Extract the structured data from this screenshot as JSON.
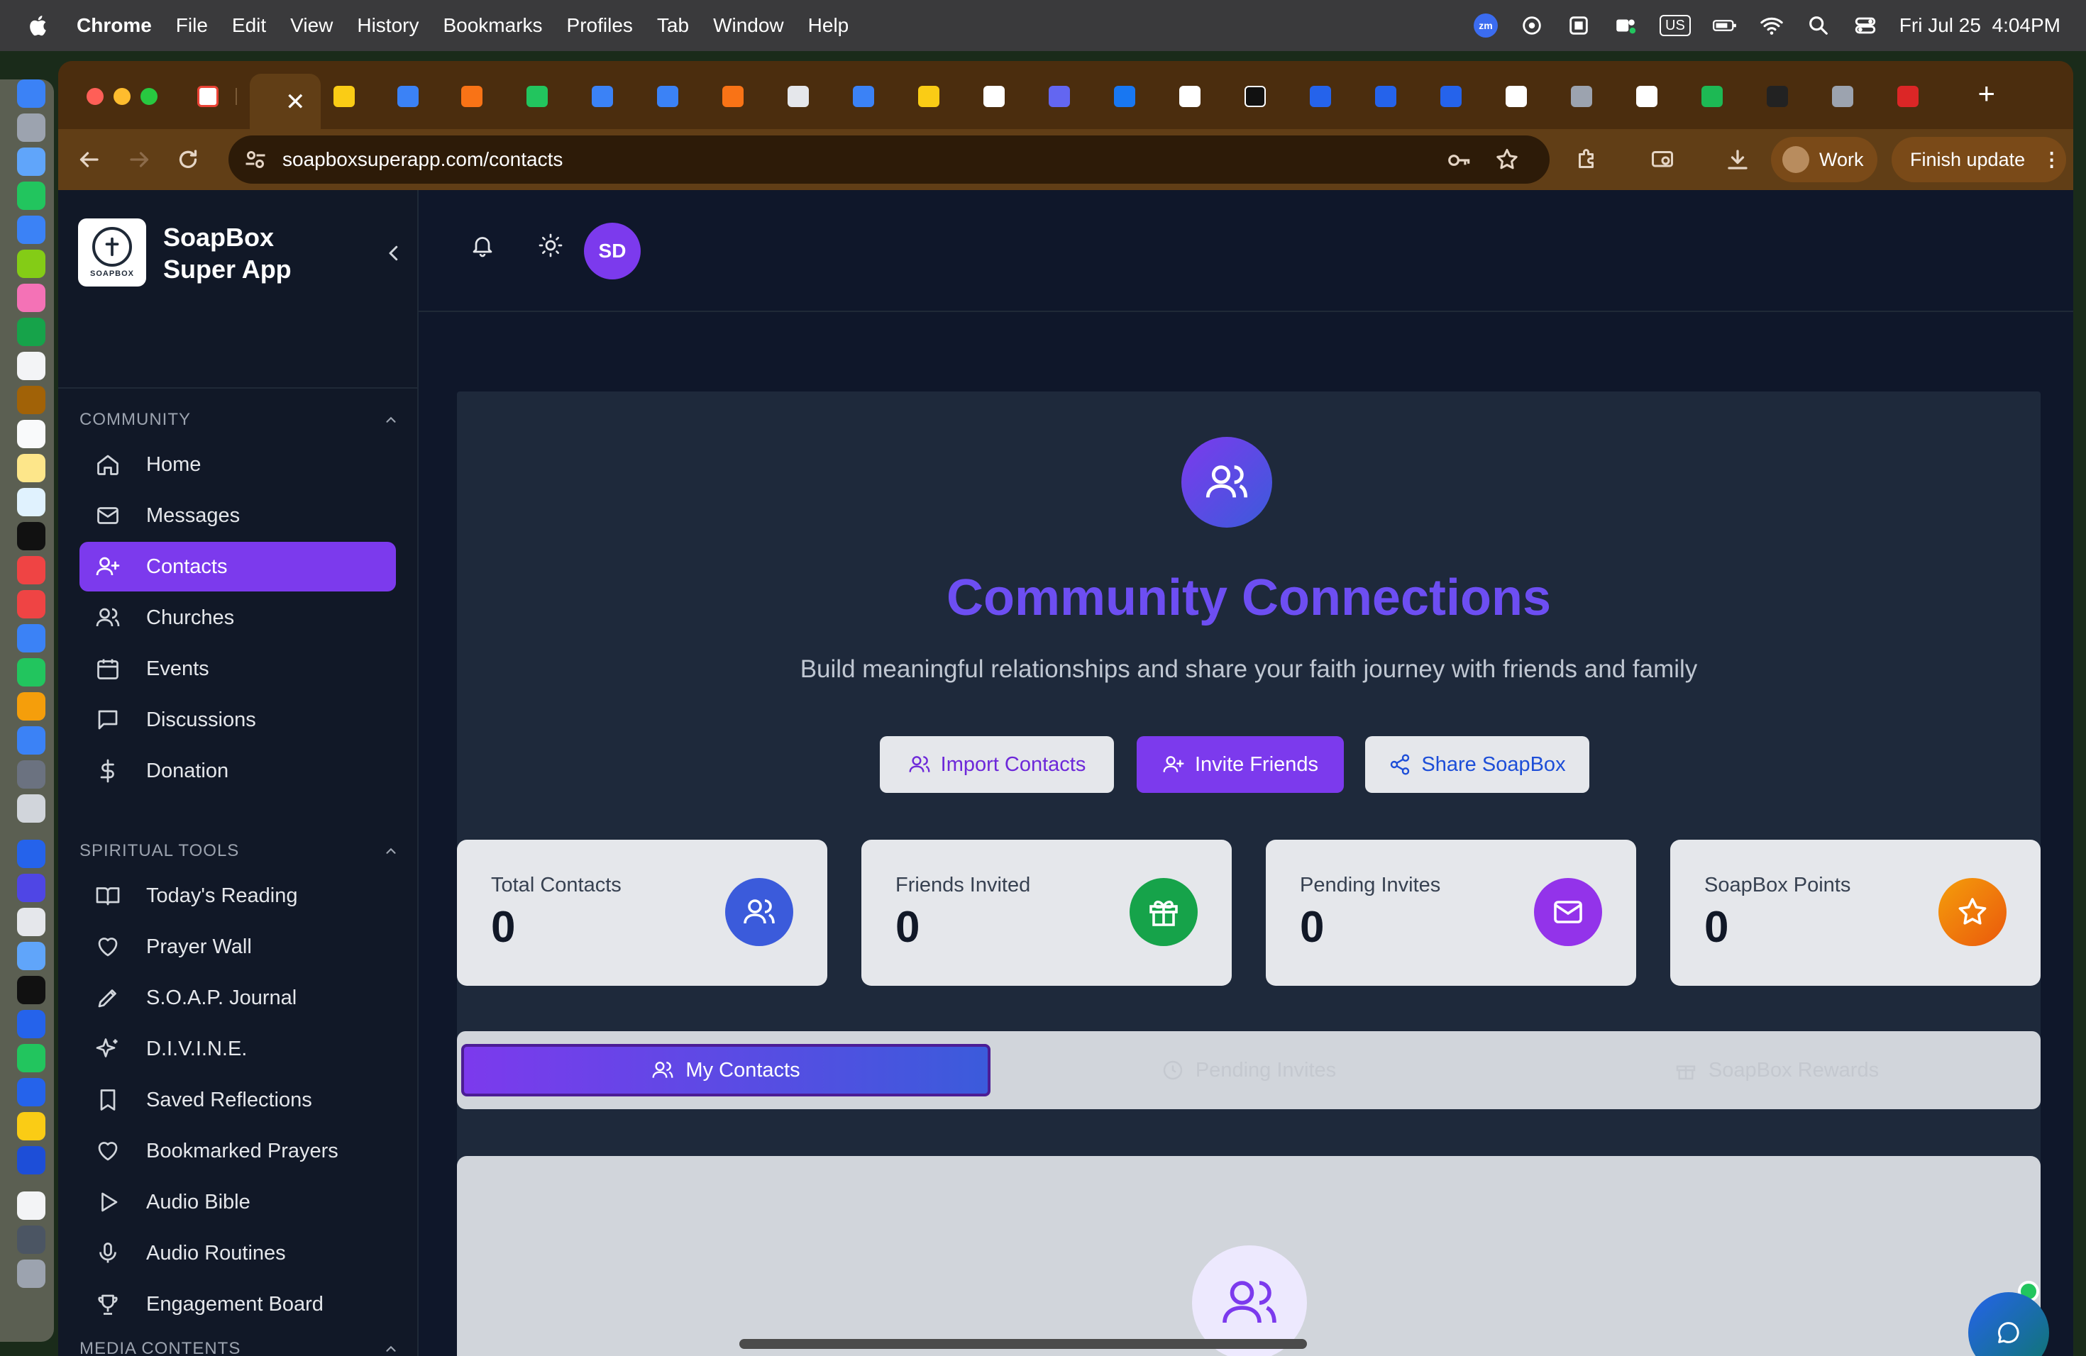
{
  "menubar": {
    "app_name": "Chrome",
    "items": [
      "File",
      "Edit",
      "View",
      "History",
      "Bookmarks",
      "Profiles",
      "Tab",
      "Window",
      "Help"
    ],
    "input_source": "US",
    "clock": "Fri Jul 25  4:04PM",
    "zoom_badge": "zm"
  },
  "browser": {
    "url": "soapboxsuperapp.com/contacts",
    "profile_label": "Work",
    "update_label": "Finish update"
  },
  "sidebar": {
    "brand_line1": "SoapBox",
    "brand_line2": "Super App",
    "logo_text": "SOAPBOX",
    "sections": [
      {
        "title": "COMMUNITY",
        "items": [
          {
            "label": "Home",
            "icon": "home-icon"
          },
          {
            "label": "Messages",
            "icon": "mail-icon"
          },
          {
            "label": "Contacts",
            "icon": "user-plus-icon",
            "active": true
          },
          {
            "label": "Churches",
            "icon": "users-icon"
          },
          {
            "label": "Events",
            "icon": "calendar-icon"
          },
          {
            "label": "Discussions",
            "icon": "chat-icon"
          },
          {
            "label": "Donation",
            "icon": "dollar-icon"
          }
        ]
      },
      {
        "title": "SPIRITUAL TOOLS",
        "items": [
          {
            "label": "Today's Reading",
            "icon": "book-icon"
          },
          {
            "label": "Prayer Wall",
            "icon": "heart-icon"
          },
          {
            "label": "S.O.A.P. Journal",
            "icon": "pen-icon"
          },
          {
            "label": "D.I.V.I.N.E.",
            "icon": "sparkles-icon"
          },
          {
            "label": "Saved Reflections",
            "icon": "bookmark-icon"
          },
          {
            "label": "Bookmarked Prayers",
            "icon": "heart-icon"
          },
          {
            "label": "Audio Bible",
            "icon": "play-icon"
          },
          {
            "label": "Audio Routines",
            "icon": "mic-icon"
          },
          {
            "label": "Engagement Board",
            "icon": "trophy-icon"
          }
        ]
      },
      {
        "title": "MEDIA CONTENTS",
        "items": []
      }
    ]
  },
  "header": {
    "avatar_initials": "SD"
  },
  "hero": {
    "title": "Community Connections",
    "subtitle": "Build meaningful relationships and share your faith journey with friends and family",
    "buttons": {
      "import": "Import Contacts",
      "invite": "Invite Friends",
      "share": "Share SoapBox"
    }
  },
  "stats": [
    {
      "label": "Total Contacts",
      "value": "0",
      "color": "#3b5bdb",
      "icon": "users-icon"
    },
    {
      "label": "Friends Invited",
      "value": "0",
      "color": "#16a34a",
      "icon": "gift-icon"
    },
    {
      "label": "Pending Invites",
      "value": "0",
      "color": "#9333ea",
      "icon": "mail-icon"
    },
    {
      "label": "SoapBox Points",
      "value": "0",
      "color": "#f59e0b",
      "icon": "star-icon"
    }
  ],
  "content_tabs": [
    {
      "label": "My Contacts",
      "active": true
    },
    {
      "label": "Pending Invites",
      "active": false
    },
    {
      "label": "SoapBox Rewards",
      "active": false
    }
  ],
  "colors": {
    "accent": "#7c3aed",
    "page_bg": "#0f172a",
    "sidebar_bg": "#111827",
    "title": "#6d4ef2"
  }
}
